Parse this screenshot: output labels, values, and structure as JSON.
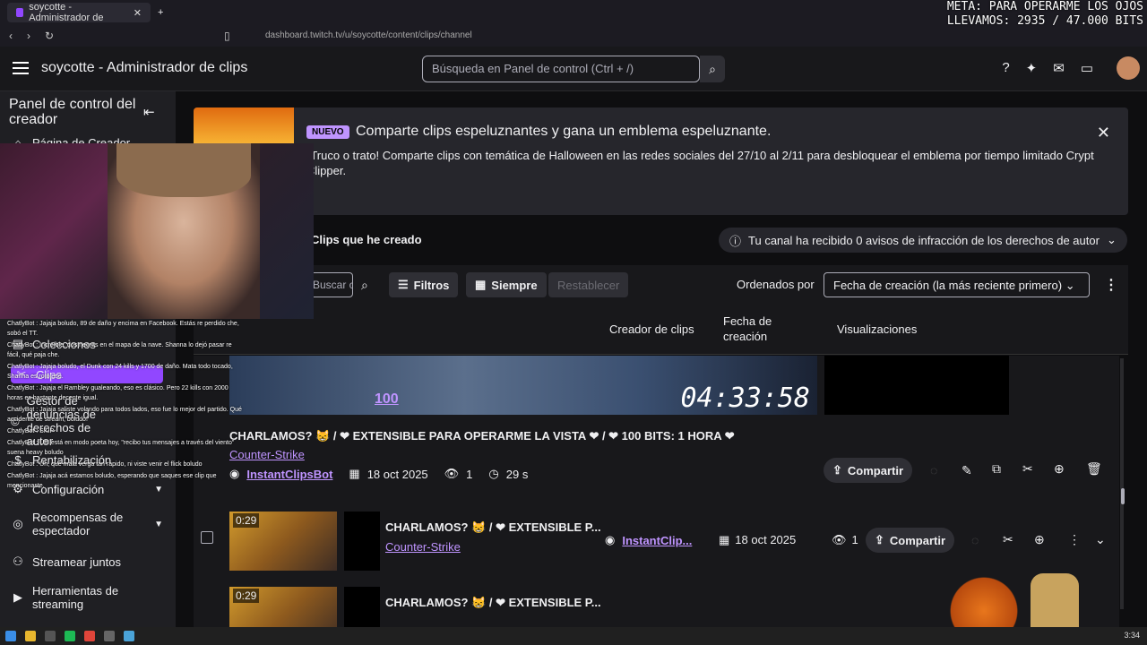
{
  "browser": {
    "tab_title": "soycotte - Administrador de",
    "new_tab": "+",
    "url": "dashboard.twitch.tv/u/soycotte/content/clips/channel"
  },
  "overlay": {
    "meta_line1": "META: PARA OPERARME LOS OJOS",
    "meta_line2": "LLEVAMOS: 2935 / 47.000 BITS"
  },
  "topbar": {
    "title": "soycotte - Administrador de clips",
    "search_placeholder": "Búsqueda en Panel de control (Ctrl + /)"
  },
  "sidebar": {
    "header": "Panel de control del creador",
    "items": [
      {
        "label": "Página de Creador",
        "icon": "home-icon"
      },
      {
        "label": "Colecciones",
        "icon": "collections-icon"
      },
      {
        "label": "Clips",
        "icon": "clip-icon"
      },
      {
        "label": "Gestor de denuncias de derechos de autor",
        "icon": "copyright-icon"
      },
      {
        "label": "Rentabilización",
        "icon": "money-icon"
      },
      {
        "label": "Configuración",
        "icon": "gear-icon"
      },
      {
        "label": "Recompensas de espectador",
        "icon": "reward-icon"
      },
      {
        "label": "Streamear juntos",
        "icon": "people-icon"
      },
      {
        "label": "Herramientas de streaming",
        "icon": "camera-icon"
      }
    ]
  },
  "chat": [
    "ChatlyBot : Jajaja boludo, 89 de daño y encima en Facebook. Estás re perdido che, sobó el TT.",
    "ChatlyBot : Increíble, dos negras en el mapa de la nave. Shanna lo dejó pasar re fácil, qué paja che.",
    "ChatlyBot : Jajaja boludo, el Dunk con 24 kills y 1700 de daño. Mata todo tocado, Shanna es roto ese.",
    "ChatlyBot : Jajaja el Rambley gualeando, eso es clásico. Pero 22 kills con 2000 horas es bastante decente igual.",
    "ChatlyBot : Jajaja saliste volando para todos lados, eso fue lo mejor del partido. Qué accidente de stream, boludo!",
    "ChatlyBot : SKIP",
    "ChatlyBot : Uff! está en modo poeta hoy, \"recibo tus mensajes a través del viento\" suena heavy boludo",
    "ChatlyBot : Uh, qué mala verga tan rápido, ni viste venir el flick boludo",
    "ChatlyBot : Jajaja acá estamos boludo, esperando que saques ese clip que mencionaste."
  ],
  "promo": {
    "badge": "NUEVO",
    "title": "Comparte clips espeluznantes y gana un emblema espeluznante.",
    "body": "¡Truco o trato! Comparte clips con temática de Halloween en las redes sociales del 27/10 al 2/11 para desbloquear el emblema por tiempo limitado Crypt Clipper."
  },
  "clips_section": {
    "header": "Clips que he creado",
    "infraction": "Tu canal ha recibido 0 avisos de infracción de los derechos de autor"
  },
  "filters": {
    "category_placeholder": "Buscar categoría",
    "filters_label": "Filtros",
    "always_label": "Siempre",
    "reset_label": "Restablecer",
    "sort_label": "Ordenados por",
    "sort_value": "Fecha de creación (la más reciente primero)"
  },
  "columns": {
    "creator": "Creador de clips",
    "date": "Fecha de creación",
    "views": "Visualizaciones"
  },
  "expanded_clip": {
    "preview_100": "100",
    "preview_timer": "04:33:58",
    "title": "CHARLAMOS? 😸 / ❤ EXTENSIBLE PARA OPERARME LA VISTA ❤ / ❤ 100 BITS: 1 HORA ❤",
    "game": "Counter-Strike",
    "creator": "InstantClipsBot",
    "date": "18 oct 2025",
    "views": "1",
    "duration": "29 s",
    "share": "Compartir"
  },
  "rows": [
    {
      "duration": "0:29",
      "title": "CHARLAMOS? 😸 / ❤ EXTENSIBLE P...",
      "game": "Counter-Strike",
      "creator": "InstantClip...",
      "date": "18 oct 2025",
      "views": "1",
      "share": "Compartir"
    },
    {
      "duration": "0:29",
      "title": "CHARLAMOS? 😸 / ❤ EXTENSIBLE P..."
    }
  ],
  "taskbar": {
    "time": "3:34"
  }
}
